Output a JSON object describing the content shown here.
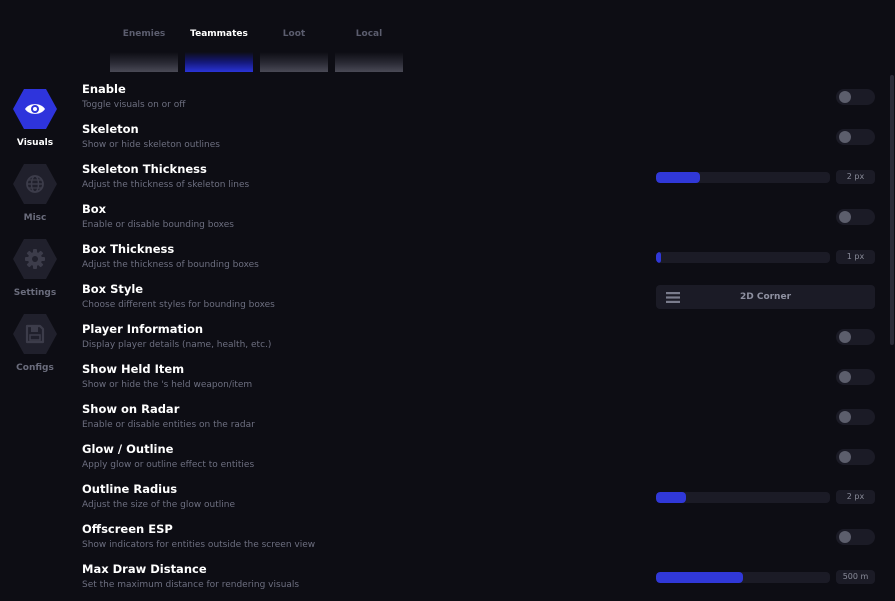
{
  "tabs": [
    {
      "label": "Enemies",
      "active": false
    },
    {
      "label": "Teammates",
      "active": true
    },
    {
      "label": "Loot",
      "active": false
    },
    {
      "label": "Local",
      "active": false
    }
  ],
  "sidebar": {
    "items": [
      {
        "label": "Visuals",
        "icon": "eye-icon",
        "active": true
      },
      {
        "label": "Misc",
        "icon": "globe-icon",
        "active": false
      },
      {
        "label": "Settings",
        "icon": "gear-icon",
        "active": false
      },
      {
        "label": "Configs",
        "icon": "save-icon",
        "active": false
      }
    ]
  },
  "settings": [
    {
      "title": "Enable",
      "desc": "Toggle visuals on or off",
      "control": "toggle",
      "on": false
    },
    {
      "title": "Skeleton",
      "desc": "Show or hide skeleton outlines",
      "control": "toggle",
      "on": false
    },
    {
      "title": "Skeleton Thickness",
      "desc": "Adjust the thickness of skeleton lines",
      "control": "slider",
      "value": "2 px",
      "fill": 0.25
    },
    {
      "title": "Box",
      "desc": "Enable or disable bounding boxes",
      "control": "toggle",
      "on": false
    },
    {
      "title": "Box Thickness",
      "desc": "Adjust the thickness of bounding boxes",
      "control": "slider",
      "value": "1 px",
      "fill": 0.03
    },
    {
      "title": "Box Style",
      "desc": "Choose different styles for bounding boxes",
      "control": "select",
      "value": "2D Corner"
    },
    {
      "title": "Player Information",
      "desc": "Display player details (name, health, etc.)",
      "control": "toggle",
      "on": false
    },
    {
      "title": "Show Held Item",
      "desc": "Show or hide the 's held weapon/item",
      "control": "toggle",
      "on": false
    },
    {
      "title": "Show on Radar",
      "desc": "Enable or disable entities on the radar",
      "control": "toggle",
      "on": false
    },
    {
      "title": "Glow / Outline",
      "desc": "Apply glow or outline effect to entities",
      "control": "toggle",
      "on": false
    },
    {
      "title": "Outline Radius",
      "desc": "Adjust the size of the glow outline",
      "control": "slider",
      "value": "2 px",
      "fill": 0.17
    },
    {
      "title": "Offscreen ESP",
      "desc": "Show indicators for entities outside the screen view",
      "control": "toggle",
      "on": false
    },
    {
      "title": "Max Draw Distance",
      "desc": "Set the maximum distance for rendering visuals",
      "control": "slider",
      "value": "500 m",
      "fill": 0.5
    }
  ],
  "colors": {
    "accent": "#2e34dc",
    "background": "#0d0d14",
    "control_bg": "#1b1b26"
  }
}
